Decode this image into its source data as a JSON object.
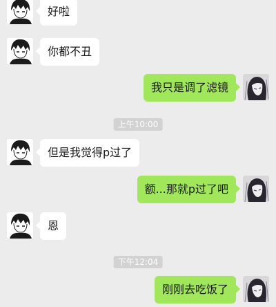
{
  "colors": {
    "background": "#ececec",
    "incoming_bubble": "#ffffff",
    "outgoing_bubble": "#a0e75a",
    "timestamp_bg": "#d2d2d2"
  },
  "messages": [
    {
      "side": "left",
      "text": "好啦"
    },
    {
      "side": "left",
      "text": "你都不丑"
    },
    {
      "side": "right",
      "text": "我只是调了滤镜"
    },
    {
      "timestamp": "上午10:00"
    },
    {
      "side": "left",
      "text": "但是我觉得p过了"
    },
    {
      "side": "right",
      "text": "额...那就p过了吧"
    },
    {
      "side": "left",
      "text": "恩"
    },
    {
      "timestamp": "下午12:04"
    },
    {
      "side": "right",
      "text": "刚刚去吃饭了"
    }
  ]
}
